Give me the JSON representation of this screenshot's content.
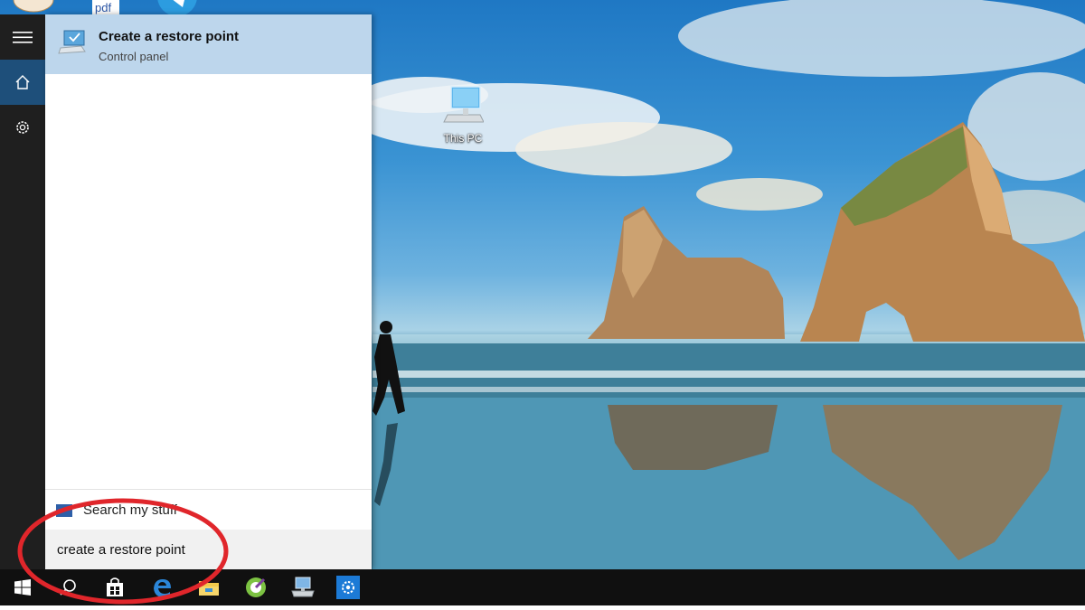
{
  "desktop": {
    "icons": [
      {
        "name": "This PC"
      }
    ],
    "top_partial_icons": [
      "paint-icon",
      "pdf-icon",
      "telegram-icon"
    ],
    "partial_pdf_text": "pdf"
  },
  "start_rail": {
    "items": [
      "hamburger-menu-icon",
      "home-icon",
      "settings-gear-icon"
    ]
  },
  "search_results": {
    "best_match": {
      "title": "Create a restore point",
      "subtitle": "Control panel",
      "icon": "computer-shield-icon"
    },
    "search_my_stuff": {
      "label": "Search my stuff",
      "icon": "windows-search-icon"
    }
  },
  "search_box": {
    "value": "create a restore point"
  },
  "taskbar": {
    "items": [
      "windows-start-icon",
      "search-icon",
      "store-icon",
      "edge-icon",
      "file-explorer-icon",
      "green-app-icon",
      "network-computer-icon",
      "settings-icon"
    ]
  },
  "colors": {
    "result_highlight": "#bdd6ec",
    "rail_background": "#1f1f1f",
    "rail_active": "#1e4f7a",
    "taskbar": "#101010",
    "annotation_red": "#e0262b"
  }
}
